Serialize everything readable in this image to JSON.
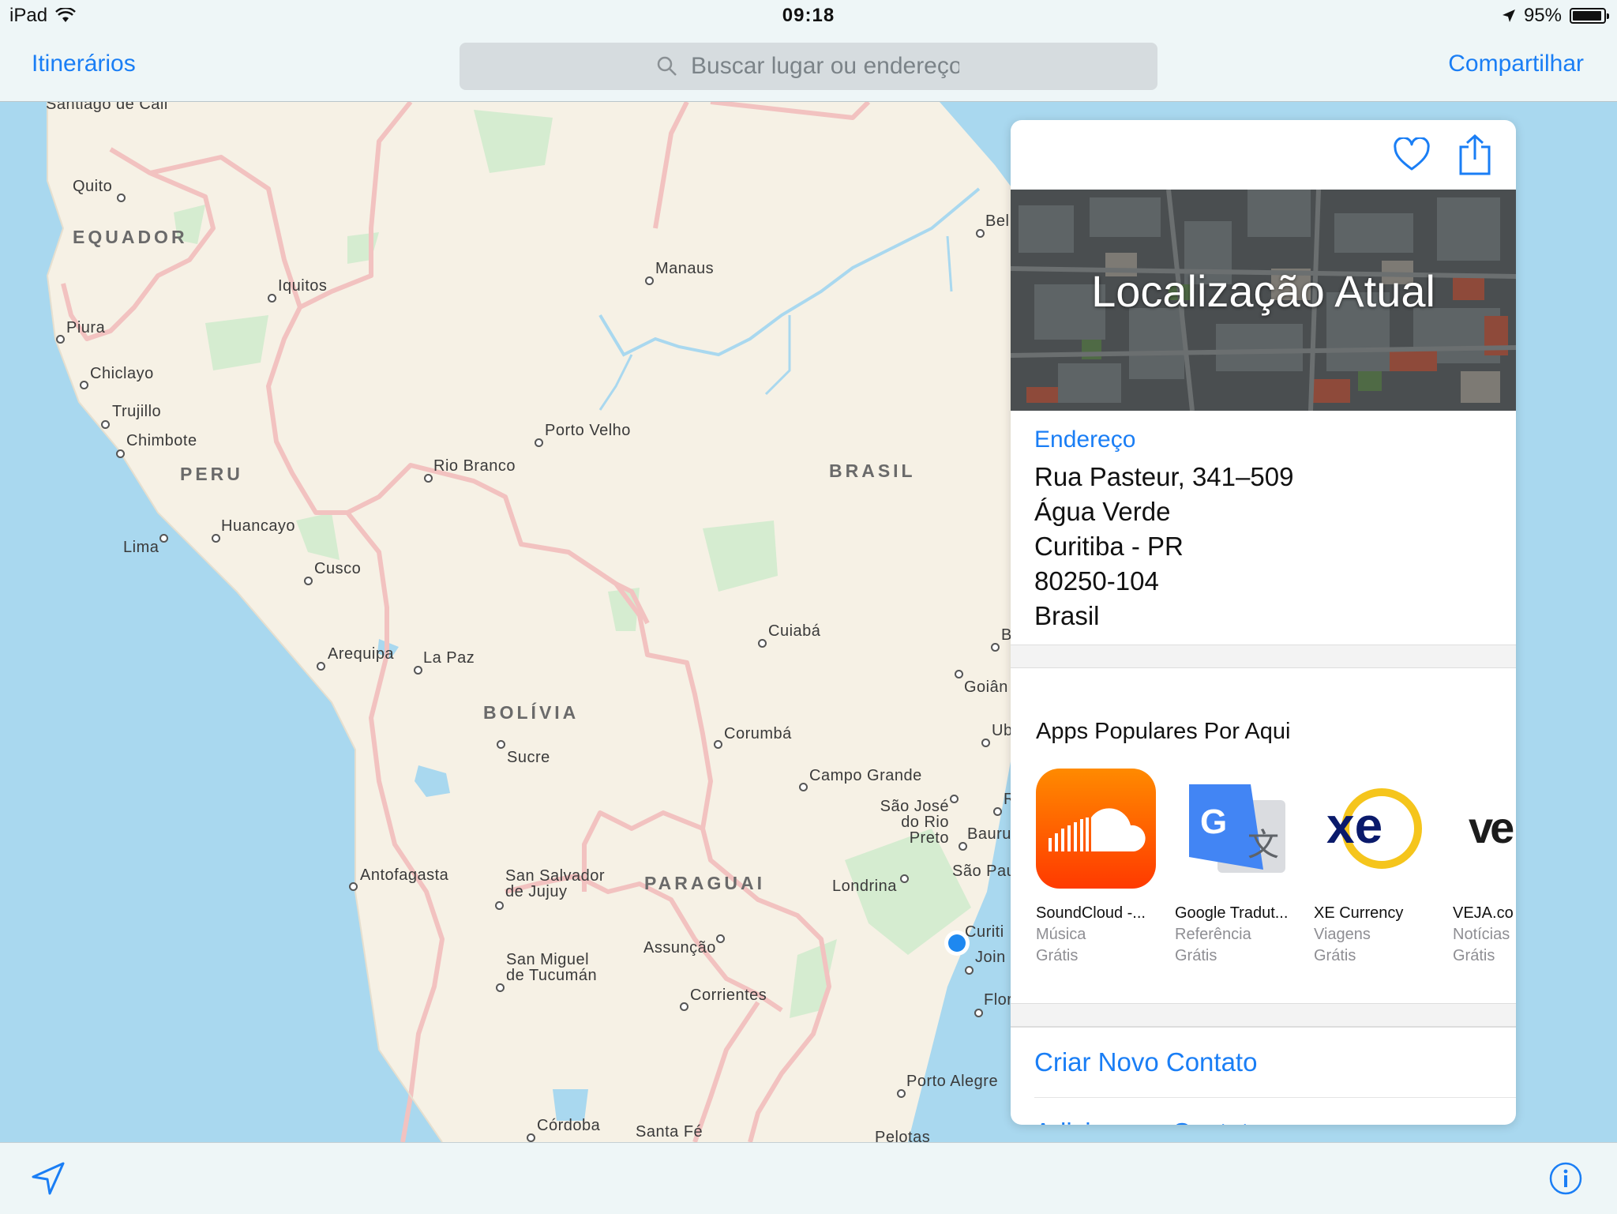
{
  "status_bar": {
    "device": "iPad",
    "time": "09:18",
    "battery": "95%",
    "battery_level": 0.95
  },
  "nav": {
    "left_label": "Itinerários",
    "search_placeholder": "Buscar lugar ou endereço",
    "right_label": "Compartilhar"
  },
  "map": {
    "countries": [
      "EQUADOR",
      "PERU",
      "BRASIL",
      "BOLÍVIA",
      "PARAGUAI"
    ],
    "cities": [
      "Santiago de Cali",
      "Quito",
      "Iquitos",
      "Piura",
      "Chiclayo",
      "Trujillo",
      "Chimbote",
      "Lima",
      "Huancayo",
      "Cusco",
      "Arequipa",
      "La Paz",
      "Manaus",
      "Porto Velho",
      "Rio Branco",
      "Cuiabá",
      "Sucre",
      "Corumbá",
      "Campo Grande",
      "São José do Rio Preto",
      "Bauru",
      "São Pau",
      "Londrina",
      "Antofagasta",
      "San Salvador de Jujuy",
      "Assunção",
      "San Miguel de Tucumán",
      "Corrientes",
      "Córdoba",
      "Santa Fé",
      "Porto Alegre",
      "Pelotas",
      "Bel",
      "Goiân",
      "Ub",
      "B",
      "R",
      "Curiti",
      "Join",
      "Flor"
    ]
  },
  "card": {
    "hero_title": "Localização Atual",
    "address_heading": "Endereço",
    "address_lines": [
      "Rua Pasteur, 341–509",
      "Água Verde",
      "Curitiba - PR",
      "80250-104",
      "Brasil"
    ],
    "apps_heading": "Apps Populares Por Aqui",
    "apps": [
      {
        "name": "SoundCloud -...",
        "category": "Música",
        "price": "Grátis",
        "icon": "soundcloud-icon"
      },
      {
        "name": "Google Tradut...",
        "category": "Referência",
        "price": "Grátis",
        "icon": "google-translate-icon"
      },
      {
        "name": "XE Currency",
        "category": "Viagens",
        "price": "Grátis",
        "icon": "xe-currency-icon"
      },
      {
        "name": "VEJA.co",
        "category": "Notícias",
        "price": "Grátis",
        "icon": "veja-icon"
      }
    ],
    "actions": [
      "Criar Novo Contato",
      "Adicionar a Contato"
    ]
  },
  "colors": {
    "accent": "#1a7ef5",
    "land": "#f6f1e5",
    "water": "#a9d8ef",
    "border": "#f2c2c0",
    "park": "#d5ecd0",
    "location_dot": "#1e88f0"
  }
}
